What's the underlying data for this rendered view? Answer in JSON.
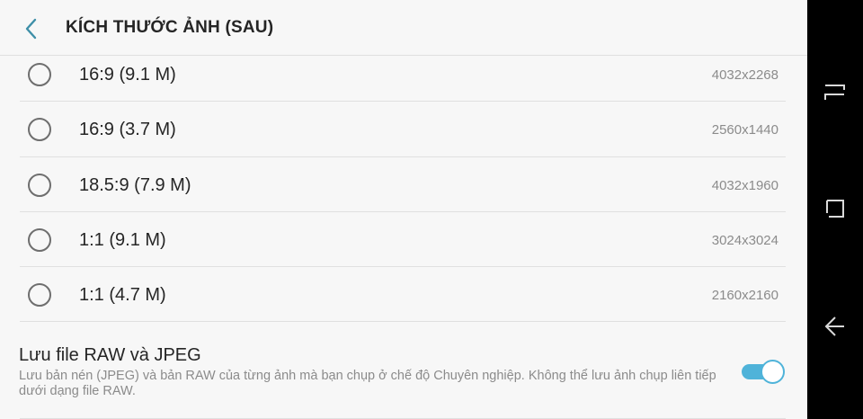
{
  "header": {
    "title": "KÍCH THƯỚC ẢNH (SAU)",
    "back_icon": "chevron-left-icon"
  },
  "options": [
    {
      "label": "16:9 (9.1 M)",
      "resolution": "4032x2268",
      "selected": false
    },
    {
      "label": "16:9 (3.7 M)",
      "resolution": "2560x1440",
      "selected": false
    },
    {
      "label": "18.5:9 (7.9 M)",
      "resolution": "4032x1960",
      "selected": false
    },
    {
      "label": "1:1 (9.1 M)",
      "resolution": "3024x3024",
      "selected": false
    },
    {
      "label": "1:1 (4.7 M)",
      "resolution": "2160x2160",
      "selected": false
    }
  ],
  "raw_setting": {
    "title": "Lưu file RAW và JPEG",
    "description": "Lưu bản nén (JPEG) và bản RAW của từng ảnh mà bạn chụp ở chế độ Chuyên nghiệp. Không thể lưu ảnh chụp liên tiếp dưới dạng file RAW.",
    "enabled": true
  },
  "navbar": {
    "icons": [
      "recent-apps-icon",
      "home-icon",
      "back-arrow-icon"
    ]
  },
  "colors": {
    "accent": "#4fb3d9",
    "back_chevron": "#3e8fa8",
    "background": "#f7f7f7",
    "navbar": "#000000"
  }
}
